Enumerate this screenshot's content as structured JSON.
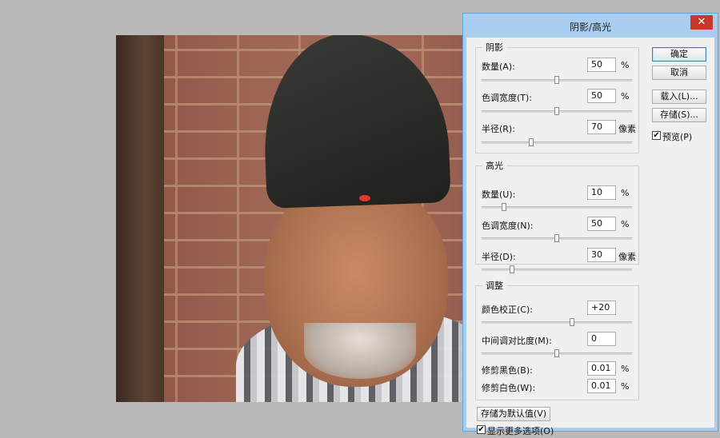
{
  "dialog": {
    "title": "阴影/高光",
    "close_glyph": "✕",
    "shadows": {
      "legend": "阴影",
      "amount": {
        "label": "数量(A):",
        "value": "50",
        "unit": "%",
        "slider": 0.5
      },
      "tonal_width": {
        "label": "色调宽度(T):",
        "value": "50",
        "unit": "%",
        "slider": 0.5
      },
      "radius": {
        "label": "半径(R):",
        "value": "70",
        "unit": "像素",
        "slider": 0.33
      }
    },
    "highlights": {
      "legend": "高光",
      "amount": {
        "label": "数量(U):",
        "value": "10",
        "unit": "%",
        "slider": 0.15
      },
      "tonal_width": {
        "label": "色调宽度(N):",
        "value": "50",
        "unit": "%",
        "slider": 0.5
      },
      "radius": {
        "label": "半径(D):",
        "value": "30",
        "unit": "像素",
        "slider": 0.2
      }
    },
    "adjustments": {
      "legend": "调整",
      "color_correction": {
        "label": "颜色校正(C):",
        "value": "+20",
        "slider": 0.6
      },
      "midtone_contrast": {
        "label": "中间调对比度(M):",
        "value": "0",
        "slider": 0.5
      },
      "black_clip": {
        "label": "修剪黑色(B):",
        "value": "0.01",
        "unit": "%"
      },
      "white_clip": {
        "label": "修剪白色(W):",
        "value": "0.01",
        "unit": "%"
      }
    },
    "buttons": {
      "ok": "确定",
      "cancel": "取消",
      "load": "载入(L)...",
      "save": "存储(S)...",
      "save_defaults": "存储为默认值(V)"
    },
    "preview": {
      "label": "预览(P)",
      "checked": true
    },
    "show_more": {
      "label": "显示更多选项(O)",
      "checked": true
    },
    "check_glyph": "✔"
  }
}
